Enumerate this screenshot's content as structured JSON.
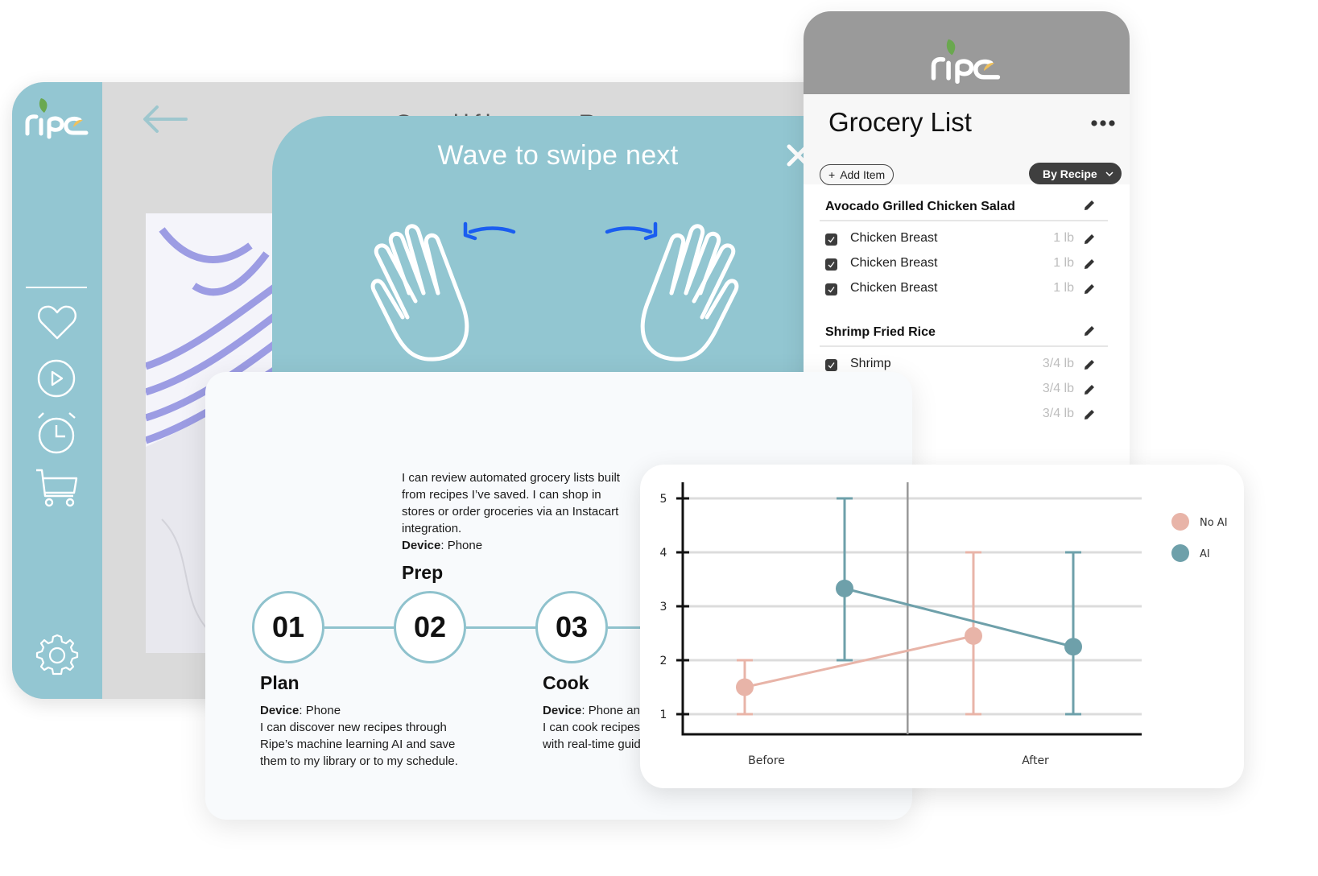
{
  "brand": {
    "name": "ripe",
    "accent": "#92c6d1",
    "leaf": "#6aa84f",
    "citrus": "#f0c05a"
  },
  "tablet": {
    "recipe_title_peek": "Cauliflower R",
    "sidebar": {
      "items": [
        {
          "icon": "heart-icon",
          "label": "Favorites"
        },
        {
          "icon": "play-icon",
          "label": "Videos"
        },
        {
          "icon": "alarm-clock-icon",
          "label": "Schedule"
        },
        {
          "icon": "cart-icon",
          "label": "Grocery"
        }
      ],
      "settings_icon": "gear-icon"
    }
  },
  "gesture_modal": {
    "title": "Wave to swipe next",
    "arrow_color": "#1a5df0"
  },
  "grocery": {
    "title": "Grocery List",
    "add_item_label": "Add Item",
    "sort_label": "By Recipe",
    "sections": [
      {
        "name": "Avocado Grilled Chicken Salad",
        "items": [
          {
            "name": "Chicken Breast",
            "qty": "1 lb",
            "checked": true
          },
          {
            "name": "Chicken Breast",
            "qty": "1 lb",
            "checked": true
          },
          {
            "name": "Chicken Breast",
            "qty": "1 lb",
            "checked": true
          }
        ]
      },
      {
        "name": "Shrimp Fried Rice",
        "items": [
          {
            "name": "Shrimp",
            "qty": "3/4 lb",
            "checked": true
          },
          {
            "name": "",
            "qty": "3/4 lb",
            "checked": false
          },
          {
            "name": "",
            "qty": "3/4 lb",
            "checked": false
          }
        ]
      }
    ]
  },
  "journey": {
    "prep_text": "I can review automated grocery lists built from recipes I’ve saved. I can shop in stores or order groceries via an Instacart integration.",
    "prep_device_label": "Device",
    "prep_device": ": Phone",
    "steps": [
      {
        "number": "01",
        "title": "Plan",
        "device_label": "Device",
        "device": ": Phone",
        "text": "I can discover new recipes through Ripe’s machine learning AI and save them to my library or to my schedule."
      },
      {
        "number": "02",
        "title": "Prep"
      },
      {
        "number": "03",
        "title": "Cook",
        "device_label": "Device",
        "device": ": Phone and",
        "text": "I can cook recipes in my kitchen with real-time guidance/control."
      }
    ]
  },
  "chart_data": {
    "type": "line",
    "title": "",
    "xlabel": "",
    "ylabel": "",
    "categories": [
      "Before",
      "After"
    ],
    "ylim": [
      1,
      5
    ],
    "yticks": [
      1,
      2,
      3,
      4,
      5
    ],
    "grid": true,
    "legend": "right",
    "series": [
      {
        "name": "No AI",
        "color": "#e8b4a8",
        "values": [
          1.5,
          2.45
        ],
        "error_low": [
          1,
          1
        ],
        "error_high": [
          2,
          4
        ]
      },
      {
        "name": "AI",
        "color": "#6ea0aa",
        "values": [
          3.33,
          2.25
        ],
        "error_low": [
          2,
          1
        ],
        "error_high": [
          5,
          4
        ]
      }
    ]
  }
}
